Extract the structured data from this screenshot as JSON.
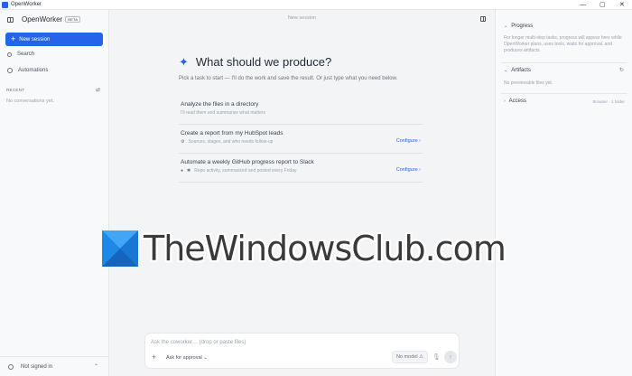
{
  "window": {
    "title": "OpenWorker",
    "controls": [
      "—",
      "▢",
      "✕"
    ]
  },
  "sidebar": {
    "brand": "OpenWorker",
    "badge": "BETA",
    "new_session_label": "New session",
    "items": [
      {
        "label": "Search",
        "icon": "search-icon"
      },
      {
        "label": "Automations",
        "icon": "clock-icon"
      }
    ],
    "recent_label": "RECENT",
    "empty_text": "No conversations yet.",
    "footer_label": "Not signed in"
  },
  "main": {
    "header": "New session",
    "hero_title": "What should we produce?",
    "hero_subtitle": "Pick a task to start — I'll do the work and save the result. Or just type what you need below.",
    "tasks": [
      {
        "title": "Analyze the files in a directory",
        "desc": "I'll read them and summarize what matters",
        "action": ""
      },
      {
        "title": "Create a report from my HubSpot leads",
        "desc": "Sources, stages, and who needs follow-up",
        "action": "Configure ›"
      },
      {
        "title": "Automate a weekly GitHub progress report to Slack",
        "desc": "Repo activity, summarized and posted every Friday",
        "action": "Configure ›"
      }
    ],
    "composer": {
      "placeholder": "Ask the coworker… (drop or paste files)",
      "approval": "Ask for approval ⌄",
      "model": "No model ⚠"
    }
  },
  "right_panel": {
    "progress_title": "Progress",
    "progress_text": "For longer multi-step tasks, progress will appear here while OpenWorker plans, uses tools, waits for approval, and produces artifacts.",
    "artifacts_title": "Artifacts",
    "artifacts_text": "No previewable files yet.",
    "access_title": "Access",
    "access_meta": "Browser · 1 folder"
  },
  "watermark": {
    "text": "TheWindowsClub.com"
  },
  "colors": {
    "accent": "#2563eb",
    "background": "#f3f4f6",
    "panel": "#f8f9fa"
  }
}
